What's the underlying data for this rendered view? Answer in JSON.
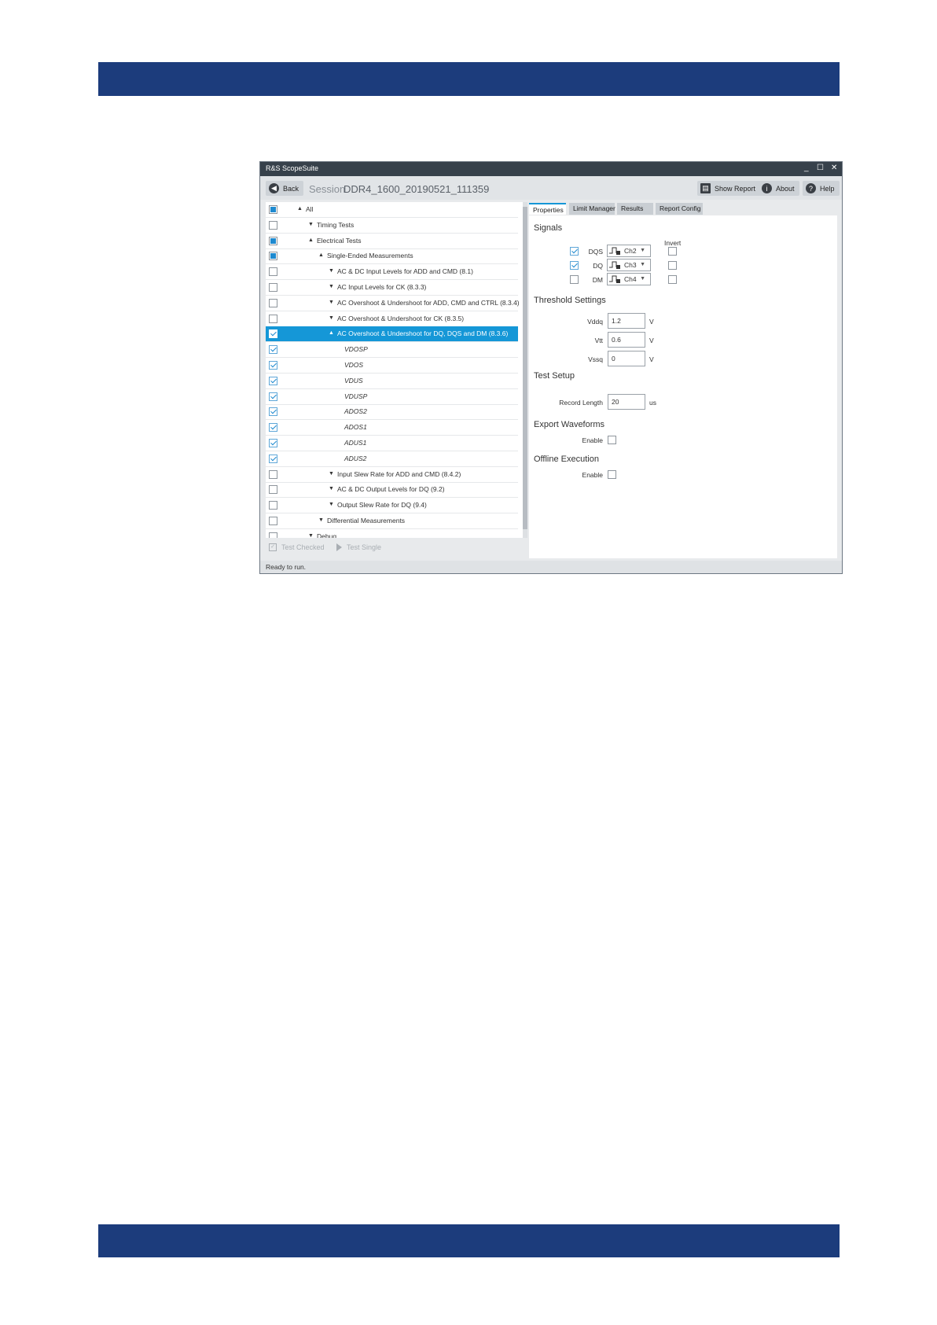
{
  "app": {
    "title": "R&S ScopeSuite",
    "window_controls": {
      "minimize": "_",
      "maximize": "☐",
      "close": "✕"
    }
  },
  "toolbar": {
    "back_label": "Back",
    "session_label": "Session",
    "session_name": "DDR4_1600_20190521_111359",
    "show_report_label": "Show Report",
    "about_label": "About",
    "help_label": "Help"
  },
  "tree": {
    "items": [
      {
        "label": "All",
        "state": "partial",
        "twisty": "▲"
      },
      {
        "label": "Timing Tests",
        "state": "unchecked",
        "twisty": "▼"
      },
      {
        "label": "Electrical Tests",
        "state": "partial",
        "twisty": "▲"
      },
      {
        "label": "Single-Ended Measurements",
        "state": "partial",
        "twisty": "▲"
      },
      {
        "label": "AC & DC Input Levels for ADD and CMD (8.1)",
        "state": "unchecked",
        "twisty": "▼"
      },
      {
        "label": "AC Input Levels for CK (8.3.3)",
        "state": "unchecked",
        "twisty": "▼"
      },
      {
        "label": "AC Overshoot & Undershoot for ADD, CMD and CTRL (8.3.4)",
        "state": "unchecked",
        "twisty": "▼"
      },
      {
        "label": "AC Overshoot & Undershoot for CK (8.3.5)",
        "state": "unchecked",
        "twisty": "▼"
      },
      {
        "label": "AC Overshoot & Undershoot for DQ, DQS and DM (8.3.6)",
        "state": "checked",
        "twisty": "▲"
      },
      {
        "label": "VDOSP",
        "state": "checked",
        "twisty": ""
      },
      {
        "label": "VDOS",
        "state": "checked",
        "twisty": ""
      },
      {
        "label": "VDUS",
        "state": "checked",
        "twisty": ""
      },
      {
        "label": "VDUSP",
        "state": "checked",
        "twisty": ""
      },
      {
        "label": "ADOS2",
        "state": "checked",
        "twisty": ""
      },
      {
        "label": "ADOS1",
        "state": "checked",
        "twisty": ""
      },
      {
        "label": "ADUS1",
        "state": "checked",
        "twisty": ""
      },
      {
        "label": "ADUS2",
        "state": "checked",
        "twisty": ""
      },
      {
        "label": "Input Slew Rate for ADD and CMD (8.4.2)",
        "state": "unchecked",
        "twisty": "▼"
      },
      {
        "label": "AC & DC Output Levels for DQ (9.2)",
        "state": "unchecked",
        "twisty": "▼"
      },
      {
        "label": "Output Slew Rate for DQ (9.4)",
        "state": "unchecked",
        "twisty": "▼"
      },
      {
        "label": "Differential Measurements",
        "state": "unchecked",
        "twisty": "▼"
      },
      {
        "label": "Debug",
        "state": "unchecked",
        "twisty": "▼"
      }
    ]
  },
  "bottom_tools": {
    "test_checked_label": "Test Checked",
    "test_single_label": "Test Single"
  },
  "status": {
    "text": "Ready to run."
  },
  "tabs": [
    {
      "label": "Properties",
      "active": true
    },
    {
      "label": "Limit Manager",
      "active": false
    },
    {
      "label": "Results",
      "active": false
    },
    {
      "label": "Report Config",
      "active": false
    }
  ],
  "properties": {
    "signals": {
      "heading": "Signals",
      "invert_label": "Invert",
      "rows": [
        {
          "name": "DQS",
          "enabled": true,
          "channel": "Ch2",
          "invert": false
        },
        {
          "name": "DQ",
          "enabled": true,
          "channel": "Ch3",
          "invert": false
        },
        {
          "name": "DM",
          "enabled": false,
          "channel": "Ch4",
          "invert": false
        }
      ]
    },
    "threshold": {
      "heading": "Threshold Settings",
      "fields": [
        {
          "label": "Vddq",
          "value": "1.2",
          "unit": "V"
        },
        {
          "label": "Vtt",
          "value": "0.6",
          "unit": "V"
        },
        {
          "label": "Vssq",
          "value": "0",
          "unit": "V"
        }
      ]
    },
    "test_setup": {
      "heading": "Test Setup",
      "record_length_label": "Record Length",
      "record_length_value": "20",
      "record_length_unit": "us"
    },
    "export": {
      "heading": "Export Waveforms",
      "enable_label": "Enable",
      "enabled": false
    },
    "offline": {
      "heading": "Offline Execution",
      "enable_label": "Enable",
      "enabled": false
    }
  },
  "colors": {
    "brand_band": "#1c3c7c",
    "selection": "#1597d7",
    "titlebar": "#37414b"
  }
}
